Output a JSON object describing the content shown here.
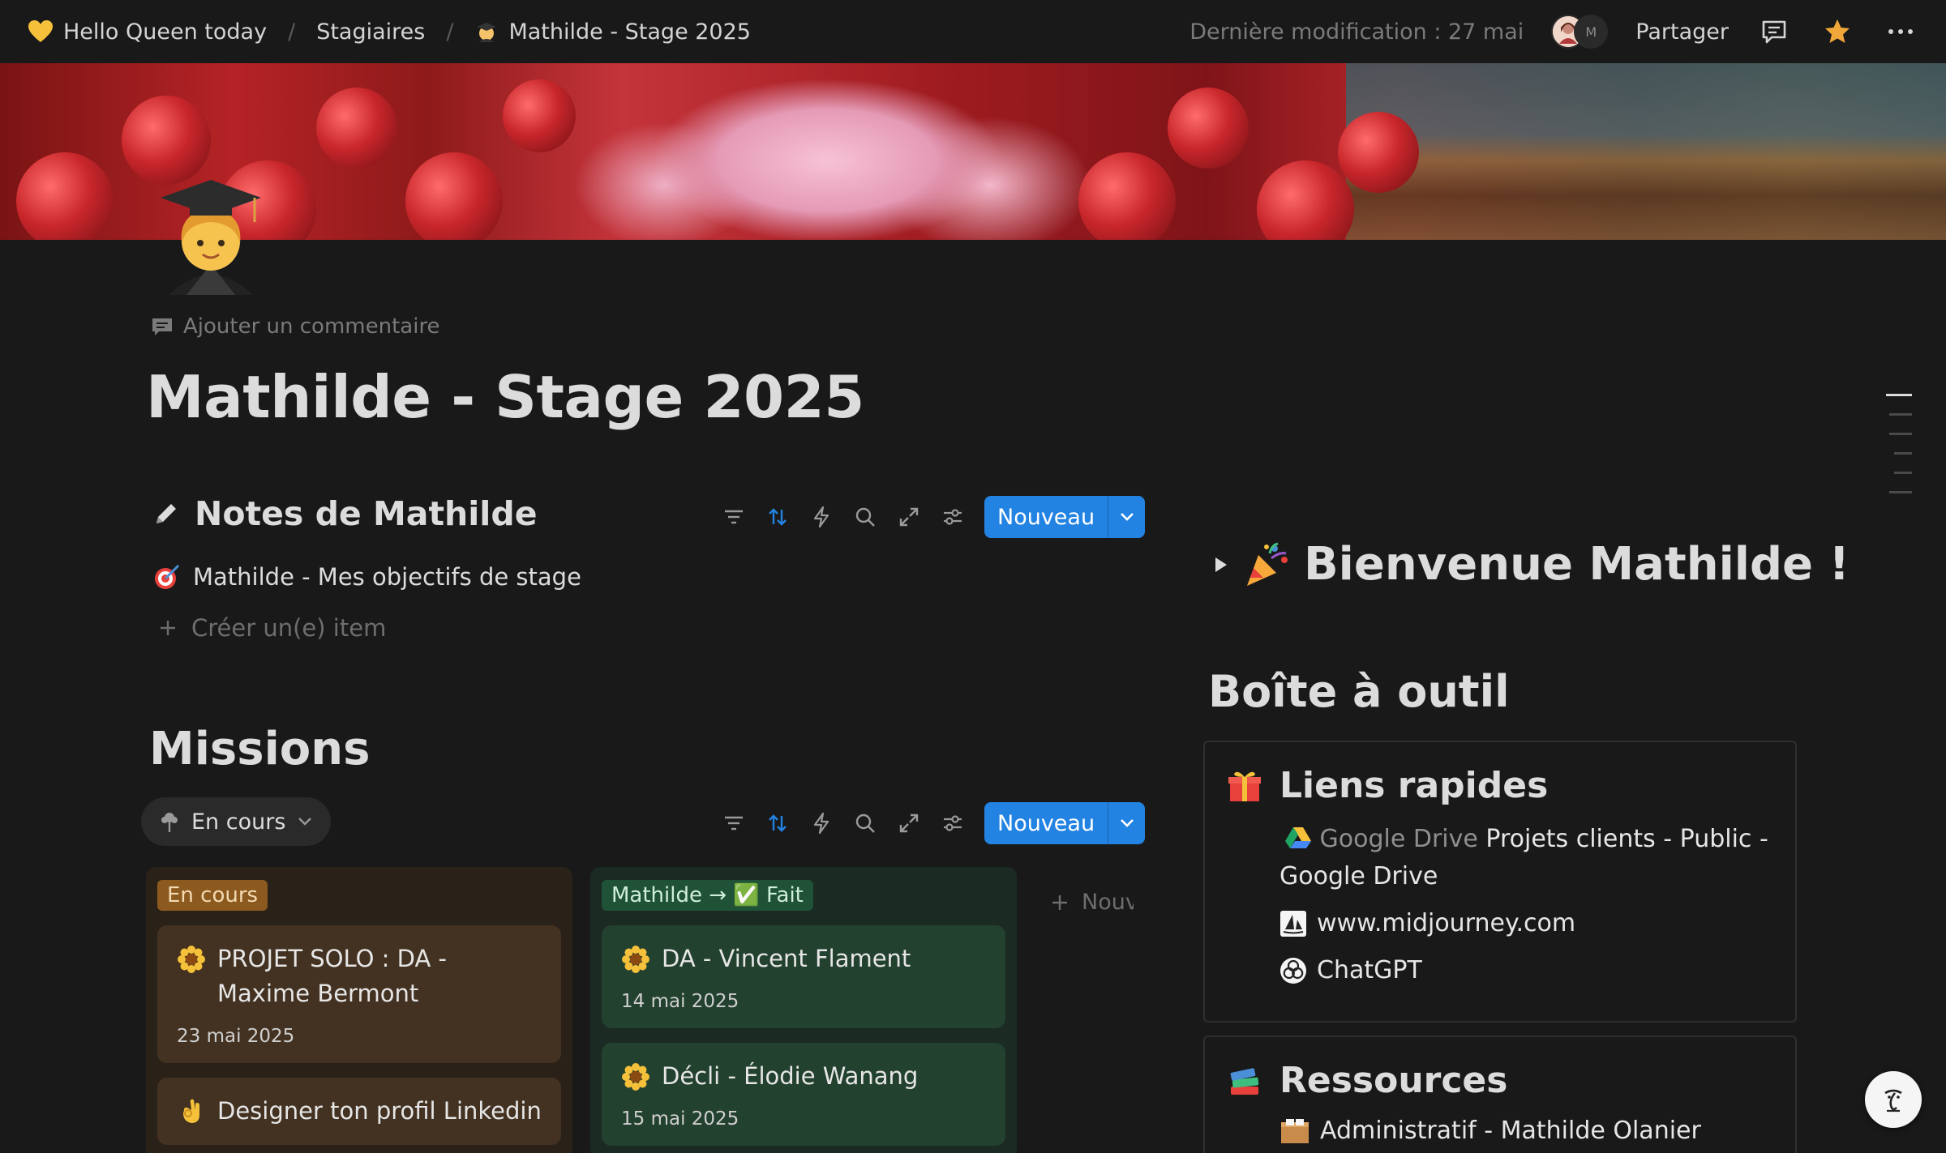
{
  "breadcrumb": {
    "workspace": "Hello Queen today",
    "parent": "Stagiaires",
    "current": "Mathilde - Stage 2025"
  },
  "topbar": {
    "last_edit": "Dernière modification : 27 mai",
    "share_label": "Partager",
    "avatar2_initial": "M"
  },
  "page": {
    "add_comment": "Ajouter un commentaire",
    "title": "Mathilde - Stage 2025"
  },
  "notes": {
    "heading": "Notes de Mathilde",
    "new_label": "Nouveau",
    "item": "Mathilde - Mes objectifs de stage",
    "create_label": "Créer un(e) item"
  },
  "missions": {
    "heading": "Missions",
    "view_label": "En cours",
    "new_label": "Nouveau",
    "new_column_label": "Nouveau groupe",
    "columns": [
      {
        "tag": "En cours",
        "cards": [
          {
            "title": "PROJET SOLO : DA - Maxime Bermont",
            "date": "23 mai 2025"
          },
          {
            "title": "Designer ton profil Linkedin",
            "date": ""
          }
        ]
      },
      {
        "tag": "Mathilde → ✅ Fait",
        "cards": [
          {
            "title": "DA - Vincent Flament",
            "date": "14 mai 2025"
          },
          {
            "title": "Décli - Élodie Wanang",
            "date": "15 mai 2025"
          }
        ]
      }
    ]
  },
  "welcome": {
    "heading": "Bienvenue Mathilde !"
  },
  "toolbox": {
    "heading": "Boîte à outil",
    "quick_links": {
      "heading": "Liens rapides",
      "links": [
        {
          "source": "Google Drive",
          "label": "Projets clients - Public - Google Drive"
        },
        {
          "label": "www.midjourney.com"
        },
        {
          "label": "ChatGPT"
        }
      ]
    },
    "resources": {
      "heading": "Ressources",
      "links": [
        {
          "label": "Administratif - Mathilde Olanier"
        }
      ]
    }
  },
  "colors": {
    "accent": "#2383e2",
    "background": "#191919",
    "tag_in_progress": "#8c5a1f",
    "tag_done": "#1f5236"
  }
}
